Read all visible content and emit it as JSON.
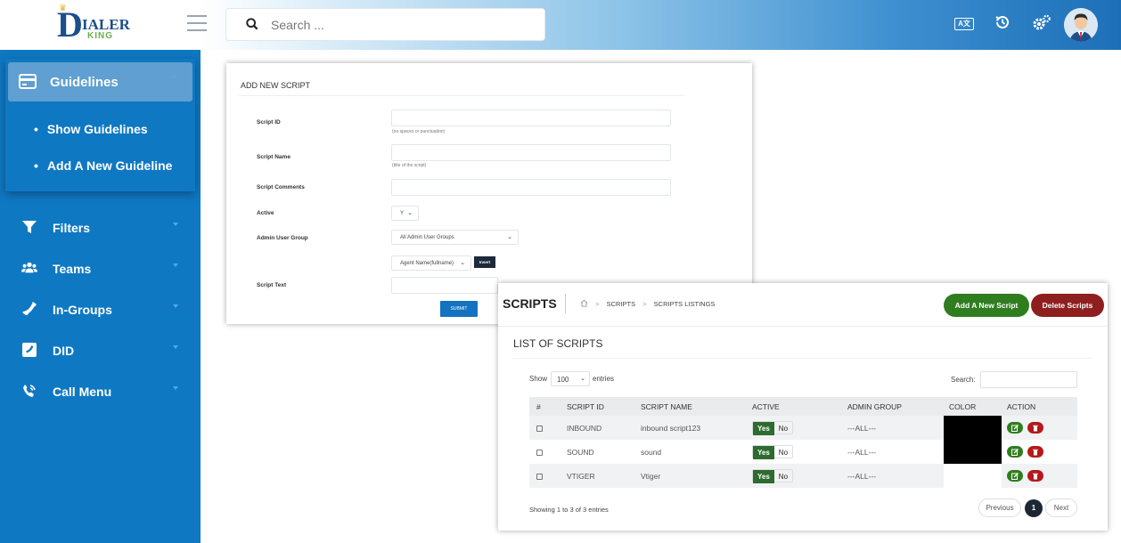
{
  "brand": {
    "logo_letter": "D",
    "logo_line1": "IALER",
    "logo_line2": "KING"
  },
  "search": {
    "placeholder": "Search ..."
  },
  "topbar": {
    "lang_icon_text": "A文"
  },
  "sidebar": {
    "active_menu": "Guidelines",
    "submenu": [
      "Show Guidelines",
      "Add A New Guideline"
    ],
    "items": [
      {
        "label": "Filters",
        "icon": "filter-icon"
      },
      {
        "label": "Teams",
        "icon": "users-icon"
      },
      {
        "label": "In-Groups",
        "icon": "phone-icon"
      },
      {
        "label": "DID",
        "icon": "phone-book-icon"
      },
      {
        "label": "Call Menu",
        "icon": "phone-ring-icon"
      }
    ]
  },
  "form": {
    "title": "ADD NEW SCRIPT",
    "script_id_label": "Script ID",
    "script_id_hint": "(no spaces or punctuation)",
    "script_name_label": "Script Name",
    "script_name_hint": "(title of the script)",
    "script_comments_label": "Script Comments",
    "active_label": "Active",
    "active_value": "Y",
    "admin_group_label": "Admin User Group",
    "admin_group_value": "All Admin User Groups",
    "agent_field_value": "Agent Name(fullname)",
    "insert_label": "Insert",
    "script_text_label": "Script Text",
    "submit_label": "SUBMIT"
  },
  "scripts": {
    "title": "SCRIPTS",
    "breadcrumb": [
      "SCRIPTS",
      "SCRIPTS LISTINGS"
    ],
    "add_button": "Add A New Script",
    "delete_button": "Delete Scripts",
    "list_title": "LIST OF SCRIPTS",
    "show_label": "Show",
    "show_value": "100",
    "entries_label": "entries",
    "search_label": "Search:",
    "columns": [
      "#",
      "SCRIPT ID",
      "SCRIPT NAME",
      "ACTIVE",
      "ADMIN GROUP",
      "COLOR",
      "ACTION"
    ],
    "rows": [
      {
        "script_id": "INBOUND",
        "script_name": "inbound script123",
        "yes": "Yes",
        "no": "No",
        "admin_group": "---ALL---",
        "color": "#000000"
      },
      {
        "script_id": "SOUND",
        "script_name": "sound",
        "yes": "Yes",
        "no": "No",
        "admin_group": "---ALL---",
        "color": "#000000"
      },
      {
        "script_id": "VTIGER",
        "script_name": "Vtiger",
        "yes": "Yes",
        "no": "No",
        "admin_group": "---ALL---",
        "color": ""
      }
    ],
    "showing_text": "Showing 1 to 3 of 3 entries",
    "pagination": {
      "previous": "Previous",
      "current": "1",
      "next": "Next"
    }
  }
}
